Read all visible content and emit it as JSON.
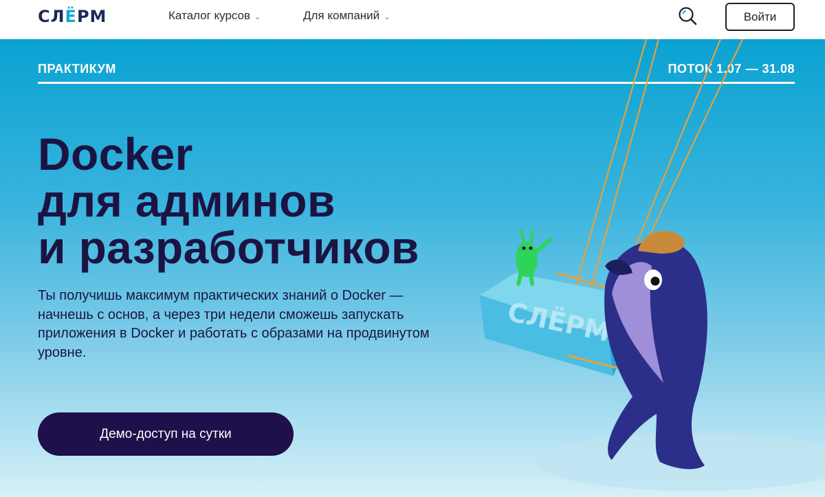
{
  "header": {
    "logo": {
      "pre": "СЛ",
      "accent": "Ё",
      "post": "РМ"
    },
    "nav": [
      {
        "label": "Каталог курсов"
      },
      {
        "label": "Для компаний"
      }
    ],
    "chevron": "⌄",
    "search_icon": "search-icon",
    "login_label": "Войти"
  },
  "hero": {
    "tagline": "ПРАКТИКУМ",
    "stream": "ПОТОК 1.07 — 31.08",
    "title_lines": [
      "Docker",
      "для админов",
      "и разработчиков"
    ],
    "description": "Ты получишь максимум практических знаний о Docker — начнешь с основ, а через три недели сможешь запускать приложения в Docker и работать с образами на продвинутом уровне.",
    "cta_label": "Демо-доступ на сутки",
    "illustration": {
      "container_text": "СЛЁРМ"
    }
  },
  "colors": {
    "accent": "#1aa6d9",
    "dark_text": "#1b1443",
    "cta_bg": "#1f0f4a",
    "hero_top": "#0aa2d2",
    "hero_bottom": "#d6f0f8",
    "whale": "#2b2f8a",
    "rope": "#e8a13a",
    "alien": "#2ed45a",
    "container": "#4fc4e6"
  }
}
